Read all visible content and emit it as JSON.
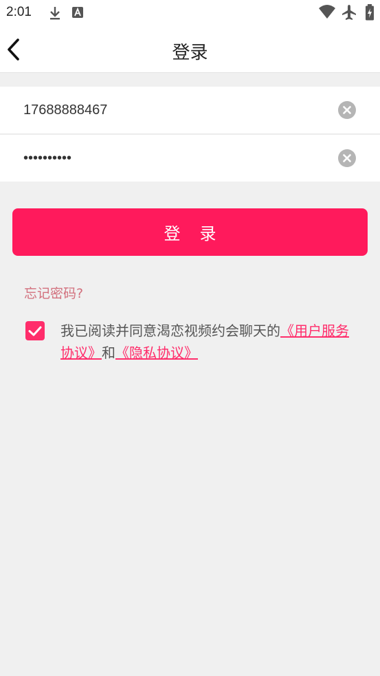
{
  "status_bar": {
    "time": "2:01",
    "icons": [
      "download-icon",
      "text-a-icon",
      "wifi-icon",
      "airplane-mode-icon",
      "battery-icon"
    ]
  },
  "header": {
    "title": "登录"
  },
  "form": {
    "phone_value": "17688888467",
    "password_value": "1234567890",
    "login_label": "登录"
  },
  "links": {
    "forgot_password": "忘记密码?"
  },
  "agreement": {
    "checked": true,
    "prefix": "我已阅读并同意渴恋视频约会聊天的",
    "user_agreement": "《用户服务协议》",
    "conjunction": "和",
    "privacy_policy": "《隐私协议》"
  },
  "colors": {
    "accent": "#ff1a5c",
    "link": "#ff2d6b",
    "forgot": "#d2707d",
    "background": "#f0f0f0"
  }
}
